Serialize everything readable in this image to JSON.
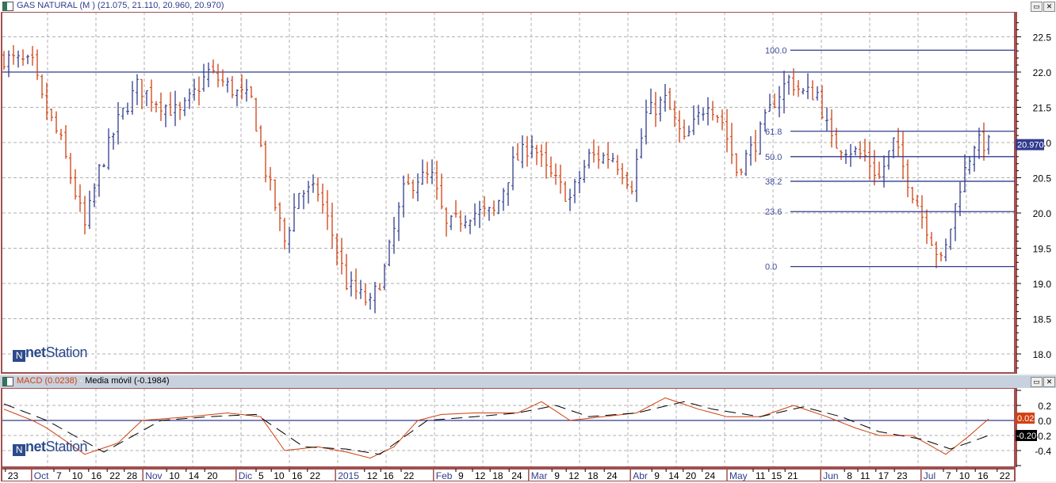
{
  "main_panel": {
    "title": "GAS NATURAL (M ) (21.075, 21.110, 20.960, 20.970)",
    "last_price": "20.970",
    "logo": "netStation",
    "logo_net": "net",
    "logo_station": "Station"
  },
  "macd_panel": {
    "title_macd": "MACD (0.0238)",
    "title_sep": " - ",
    "title_ma": "Media móvil (-0.1984)",
    "macd_value": "0.02",
    "signal_value": "-0.20"
  },
  "colors": {
    "up": "#303c8c",
    "down": "#d04010",
    "macd": "#d04010",
    "signal": "#000000",
    "grid": "#b0b0b0",
    "frame": "#a05050"
  },
  "chart_data": [
    {
      "type": "ohlc",
      "title": "GAS NATURAL (M )",
      "bars": 210,
      "close_keypoints": [
        [
          0,
          22.2
        ],
        [
          6,
          22.1
        ],
        [
          8,
          21.6
        ],
        [
          12,
          21.0
        ],
        [
          17,
          19.8
        ],
        [
          20,
          20.6
        ],
        [
          24,
          21.3
        ],
        [
          28,
          21.8
        ],
        [
          32,
          21.6
        ],
        [
          37,
          21.4
        ],
        [
          43,
          22.0
        ],
        [
          49,
          21.7
        ],
        [
          52,
          21.6
        ],
        [
          55,
          20.6
        ],
        [
          59,
          19.6
        ],
        [
          62,
          20.3
        ],
        [
          66,
          20.3
        ],
        [
          69,
          19.7
        ],
        [
          72,
          19.0
        ],
        [
          77,
          18.7
        ],
        [
          80,
          19.2
        ],
        [
          84,
          20.3
        ],
        [
          87,
          20.5
        ],
        [
          90,
          20.5
        ],
        [
          93,
          19.8
        ],
        [
          98,
          20.0
        ],
        [
          103,
          20.0
        ],
        [
          107,
          20.7
        ],
        [
          111,
          21.0
        ],
        [
          114,
          20.6
        ],
        [
          119,
          20.2
        ],
        [
          123,
          20.8
        ],
        [
          128,
          20.8
        ],
        [
          132,
          20.4
        ],
        [
          135,
          21.4
        ],
        [
          139,
          21.6
        ],
        [
          143,
          21.0
        ],
        [
          148,
          21.6
        ],
        [
          151,
          21.3
        ],
        [
          154,
          20.6
        ],
        [
          158,
          21.0
        ],
        [
          162,
          21.6
        ],
        [
          165,
          21.9
        ],
        [
          168,
          21.7
        ],
        [
          171,
          21.7
        ],
        [
          174,
          21.0
        ],
        [
          178,
          20.9
        ],
        [
          181,
          20.8
        ],
        [
          184,
          20.5
        ],
        [
          187,
          21.0
        ],
        [
          191,
          20.3
        ],
        [
          194,
          19.8
        ],
        [
          197,
          19.3
        ],
        [
          198,
          19.5
        ],
        [
          201,
          20.4
        ],
        [
          204,
          21.0
        ],
        [
          207,
          20.97
        ]
      ],
      "ylim": [
        17.7,
        23.0
      ],
      "yticks": [
        18.0,
        18.5,
        19.0,
        19.5,
        20.0,
        20.5,
        21.0,
        21.5,
        22.0,
        22.5
      ],
      "ytick_labels": [
        "18.0",
        "18.5",
        "19.0",
        "19.5",
        "20.0",
        "20.5",
        "21.0",
        "21.5",
        "22.0",
        "22.5"
      ],
      "hline": 22.0,
      "fibonacci": {
        "start_bar": 165,
        "levels": [
          {
            "label": "100.0",
            "price": 22.31
          },
          {
            "label": "61.8",
            "price": 21.16
          },
          {
            "label": "50.0",
            "price": 20.8
          },
          {
            "label": "38.2",
            "price": 20.45
          },
          {
            "label": "23.6",
            "price": 20.02
          },
          {
            "label": "0.0",
            "price": 19.24
          }
        ]
      }
    },
    {
      "type": "line",
      "title": "MACD",
      "ylim": [
        -0.6,
        0.4
      ],
      "yticks": [
        0.2,
        0.0,
        -0.2,
        -0.4
      ],
      "ytick_labels": [
        "0.2",
        "0.0",
        "-0.2",
        "-0.4"
      ],
      "series": [
        {
          "name": "MACD",
          "style": "solid",
          "points": [
            [
              0,
              0.15
            ],
            [
              6,
              0.0
            ],
            [
              9,
              -0.1
            ],
            [
              17,
              -0.45
            ],
            [
              24,
              -0.3
            ],
            [
              29,
              0.0
            ],
            [
              39,
              0.05
            ],
            [
              47,
              0.1
            ],
            [
              54,
              0.05
            ],
            [
              59,
              -0.4
            ],
            [
              66,
              -0.35
            ],
            [
              72,
              -0.42
            ],
            [
              77,
              -0.5
            ],
            [
              82,
              -0.35
            ],
            [
              87,
              0.0
            ],
            [
              92,
              0.08
            ],
            [
              99,
              0.1
            ],
            [
              108,
              0.1
            ],
            [
              113,
              0.25
            ],
            [
              119,
              0.0
            ],
            [
              126,
              0.05
            ],
            [
              133,
              0.1
            ],
            [
              139,
              0.3
            ],
            [
              146,
              0.15
            ],
            [
              152,
              0.05
            ],
            [
              159,
              0.05
            ],
            [
              166,
              0.2
            ],
            [
              173,
              0.05
            ],
            [
              179,
              -0.1
            ],
            [
              184,
              -0.2
            ],
            [
              191,
              -0.2
            ],
            [
              198,
              -0.45
            ],
            [
              203,
              -0.2
            ],
            [
              207,
              0.02
            ]
          ]
        },
        {
          "name": "Media móvil",
          "style": "dashed",
          "points": [
            [
              0,
              0.22
            ],
            [
              9,
              0.0
            ],
            [
              21,
              -0.42
            ],
            [
              33,
              0.0
            ],
            [
              43,
              0.05
            ],
            [
              53,
              0.08
            ],
            [
              63,
              -0.35
            ],
            [
              72,
              -0.38
            ],
            [
              79,
              -0.45
            ],
            [
              89,
              0.0
            ],
            [
              99,
              0.05
            ],
            [
              108,
              0.1
            ],
            [
              116,
              0.2
            ],
            [
              123,
              0.05
            ],
            [
              133,
              0.1
            ],
            [
              143,
              0.25
            ],
            [
              149,
              0.15
            ],
            [
              159,
              0.05
            ],
            [
              168,
              0.18
            ],
            [
              176,
              0.05
            ],
            [
              184,
              -0.15
            ],
            [
              193,
              -0.25
            ],
            [
              199,
              -0.38
            ],
            [
              207,
              -0.2
            ]
          ]
        }
      ]
    },
    {
      "type": "x_axis",
      "ticks": [
        [
          0.3,
          "23"
        ],
        [
          5.8,
          "Oct"
        ],
        [
          10.5,
          "7"
        ],
        [
          13.8,
          "10"
        ],
        [
          17.8,
          "16"
        ],
        [
          21.7,
          "22"
        ],
        [
          25.3,
          "28"
        ],
        [
          29.2,
          "Nov"
        ],
        [
          34.2,
          "10"
        ],
        [
          38.3,
          "14"
        ],
        [
          42.2,
          "20"
        ],
        [
          48.8,
          "Dic"
        ],
        [
          53,
          "5"
        ],
        [
          56.2,
          "10"
        ],
        [
          60,
          "16"
        ],
        [
          63.8,
          "22"
        ],
        [
          69.7,
          "2015"
        ],
        [
          75.8,
          "12"
        ],
        [
          79.2,
          "16"
        ],
        [
          83.5,
          "22"
        ],
        [
          90.3,
          "Feb"
        ],
        [
          95,
          "9"
        ],
        [
          98.5,
          "12"
        ],
        [
          102.2,
          "18"
        ],
        [
          106.2,
          "24"
        ],
        [
          110.3,
          "Mar"
        ],
        [
          115.2,
          "9"
        ],
        [
          118.2,
          "12"
        ],
        [
          122.2,
          "18"
        ],
        [
          126.2,
          "24"
        ],
        [
          131.7,
          "Abr"
        ],
        [
          136.2,
          "9"
        ],
        [
          139.2,
          "14"
        ],
        [
          142.8,
          "20"
        ],
        [
          146.8,
          "24"
        ],
        [
          152,
          "May"
        ],
        [
          157.5,
          "11"
        ],
        [
          160.8,
          "15"
        ],
        [
          164.2,
          "21"
        ],
        [
          171.7,
          "Jun"
        ],
        [
          176.7,
          "8"
        ],
        [
          179.5,
          "11"
        ],
        [
          183.3,
          "17"
        ],
        [
          187.2,
          "23"
        ],
        [
          192.8,
          "Jul"
        ],
        [
          197.5,
          "7"
        ],
        [
          200.3,
          "10"
        ],
        [
          204.2,
          "16"
        ],
        [
          208.8,
          "22"
        ]
      ]
    }
  ]
}
